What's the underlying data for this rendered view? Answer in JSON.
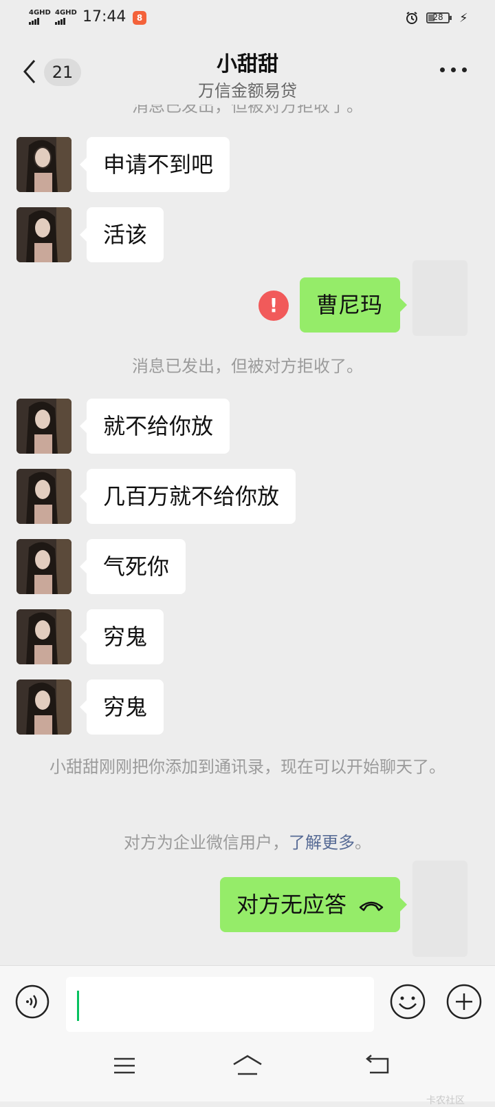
{
  "status_bar": {
    "signal_1": "4GHD",
    "signal_2": "4GHD",
    "time": "17:44",
    "app_badge": "8",
    "battery": "28",
    "icons": [
      "alarm-icon",
      "charging-bolt-icon"
    ]
  },
  "header": {
    "unread_count": "21",
    "title": "小甜甜",
    "subtitle": "万信金额易贷",
    "more_icon": "more-dots-icon"
  },
  "messages": {
    "top_system_partial": "消息已发出，但被对方拒收了。",
    "in_1": "申请不到吧",
    "in_2": "活该",
    "out_1": "曹尼玛",
    "out_1_error": "!",
    "system_rejected": "消息已发出，但被对方拒收了。",
    "in_3": "就不给你放",
    "in_4": "几百万就不给你放",
    "in_5": "气死你",
    "in_6": "穷鬼",
    "in_7": "穷鬼",
    "system_added": "小甜甜刚刚把你添加到通讯录，现在可以开始聊天了。",
    "system_enterprise": "对方为企业微信用户，",
    "system_enterprise_link": "了解更多",
    "system_enterprise_end": "。",
    "out_call": "对方无应答"
  },
  "input_bar": {
    "icons": [
      "voice-icon",
      "emoji-icon",
      "plus-icon"
    ]
  },
  "nav_bar": {
    "icons": [
      "menu-icon",
      "home-icon",
      "back-icon"
    ]
  },
  "watermark": "卡农社区",
  "colors": {
    "background": "#ededed",
    "incoming_bubble": "#ffffff",
    "outgoing_bubble": "#95ec69",
    "error_red": "#f15a5a",
    "link": "#576b95",
    "caret": "#07c160"
  }
}
